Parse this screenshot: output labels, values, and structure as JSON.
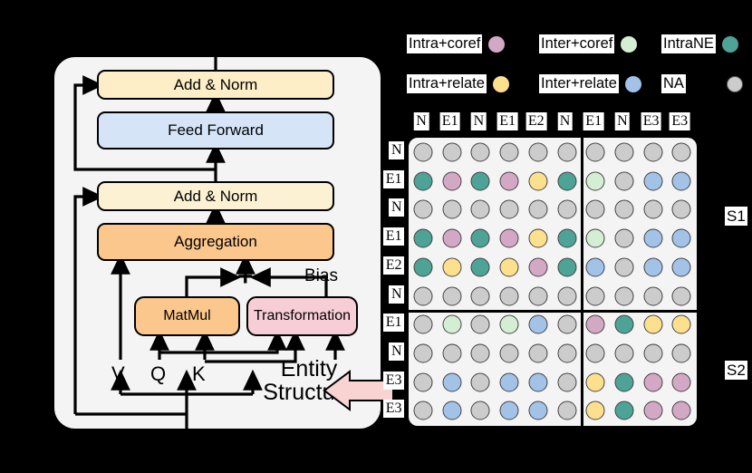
{
  "architecture": {
    "blocks": [
      {
        "id": "addnorm1",
        "label": "Add & Norm",
        "color": "#fdeec8"
      },
      {
        "id": "feedforward",
        "label": "Feed Forward",
        "color": "#d6e4f7"
      },
      {
        "id": "addnorm2",
        "label": "Add & Norm",
        "color": "#fdf1d4"
      },
      {
        "id": "aggregation",
        "label": "Aggregation",
        "color": "#fbc78c"
      },
      {
        "id": "matmul",
        "label": "MatMul",
        "color": "#fbc78c"
      },
      {
        "id": "transformation",
        "label": "Transformation",
        "color": "#f7ced5"
      }
    ],
    "labels": {
      "bias": "Bias",
      "v": "V",
      "q": "Q",
      "k": "K",
      "entity_structure": "Entity\nStructure",
      "entity_structure_line1": "Entity",
      "entity_structure_line2": "Structure",
      "plus": "+"
    }
  },
  "legend": {
    "items": [
      {
        "label": "Intra+coref",
        "color": "#d3a8c4",
        "row": 0,
        "col": 0
      },
      {
        "label": "Inter+coref",
        "color": "#d4eed3",
        "row": 0,
        "col": 1
      },
      {
        "label": "IntraNE",
        "color": "#4ca396",
        "row": 0,
        "col": 2
      },
      {
        "label": "Intra+relate",
        "color": "#fce08e",
        "row": 1,
        "col": 0
      },
      {
        "label": "Inter+relate",
        "color": "#a2c2e8",
        "row": 1,
        "col": 1
      },
      {
        "label": "NA",
        "color": "#cccccc",
        "row": 1,
        "col": 2
      }
    ]
  },
  "matrix": {
    "column_headers": [
      "N",
      "E1",
      "N",
      "E1",
      "E2",
      "N",
      "E1",
      "N",
      "E3",
      "E3"
    ],
    "row_headers": [
      "N",
      "E1",
      "N",
      "E1",
      "E2",
      "N",
      "E1",
      "N",
      "E3",
      "E3"
    ],
    "sentence_labels": {
      "s1": "S1",
      "s2": "S2"
    },
    "split_after_column": 6,
    "split_after_row": 6,
    "color_key": {
      "na": "#cccccc",
      "intra_coref": "#d3a8c4",
      "inter_coref": "#d4eed3",
      "intra_ne": "#4ca396",
      "intra_relate": "#fce08e",
      "inter_relate": "#a2c2e8"
    },
    "cells": [
      [
        "na",
        "na",
        "na",
        "na",
        "na",
        "na",
        "na",
        "na",
        "na",
        "na"
      ],
      [
        "intra_ne",
        "intra_coref",
        "intra_ne",
        "intra_coref",
        "intra_relate",
        "intra_ne",
        "inter_coref",
        "na",
        "inter_relate",
        "inter_relate"
      ],
      [
        "na",
        "na",
        "na",
        "na",
        "na",
        "na",
        "na",
        "na",
        "na",
        "na"
      ],
      [
        "intra_ne",
        "intra_coref",
        "intra_ne",
        "intra_coref",
        "intra_relate",
        "intra_ne",
        "inter_coref",
        "na",
        "inter_relate",
        "inter_relate"
      ],
      [
        "intra_ne",
        "intra_relate",
        "intra_ne",
        "intra_relate",
        "intra_coref",
        "intra_ne",
        "inter_relate",
        "na",
        "inter_relate",
        "inter_relate"
      ],
      [
        "na",
        "na",
        "na",
        "na",
        "na",
        "na",
        "na",
        "na",
        "na",
        "na"
      ],
      [
        "na",
        "inter_coref",
        "na",
        "inter_coref",
        "inter_relate",
        "na",
        "intra_coref",
        "intra_ne",
        "intra_relate",
        "intra_relate"
      ],
      [
        "na",
        "na",
        "na",
        "na",
        "na",
        "na",
        "na",
        "na",
        "na",
        "na"
      ],
      [
        "na",
        "inter_relate",
        "na",
        "inter_relate",
        "inter_relate",
        "na",
        "intra_relate",
        "intra_ne",
        "intra_coref",
        "intra_coref"
      ],
      [
        "na",
        "inter_relate",
        "na",
        "inter_relate",
        "inter_relate",
        "na",
        "intra_relate",
        "intra_ne",
        "intra_coref",
        "intra_coref"
      ]
    ]
  }
}
